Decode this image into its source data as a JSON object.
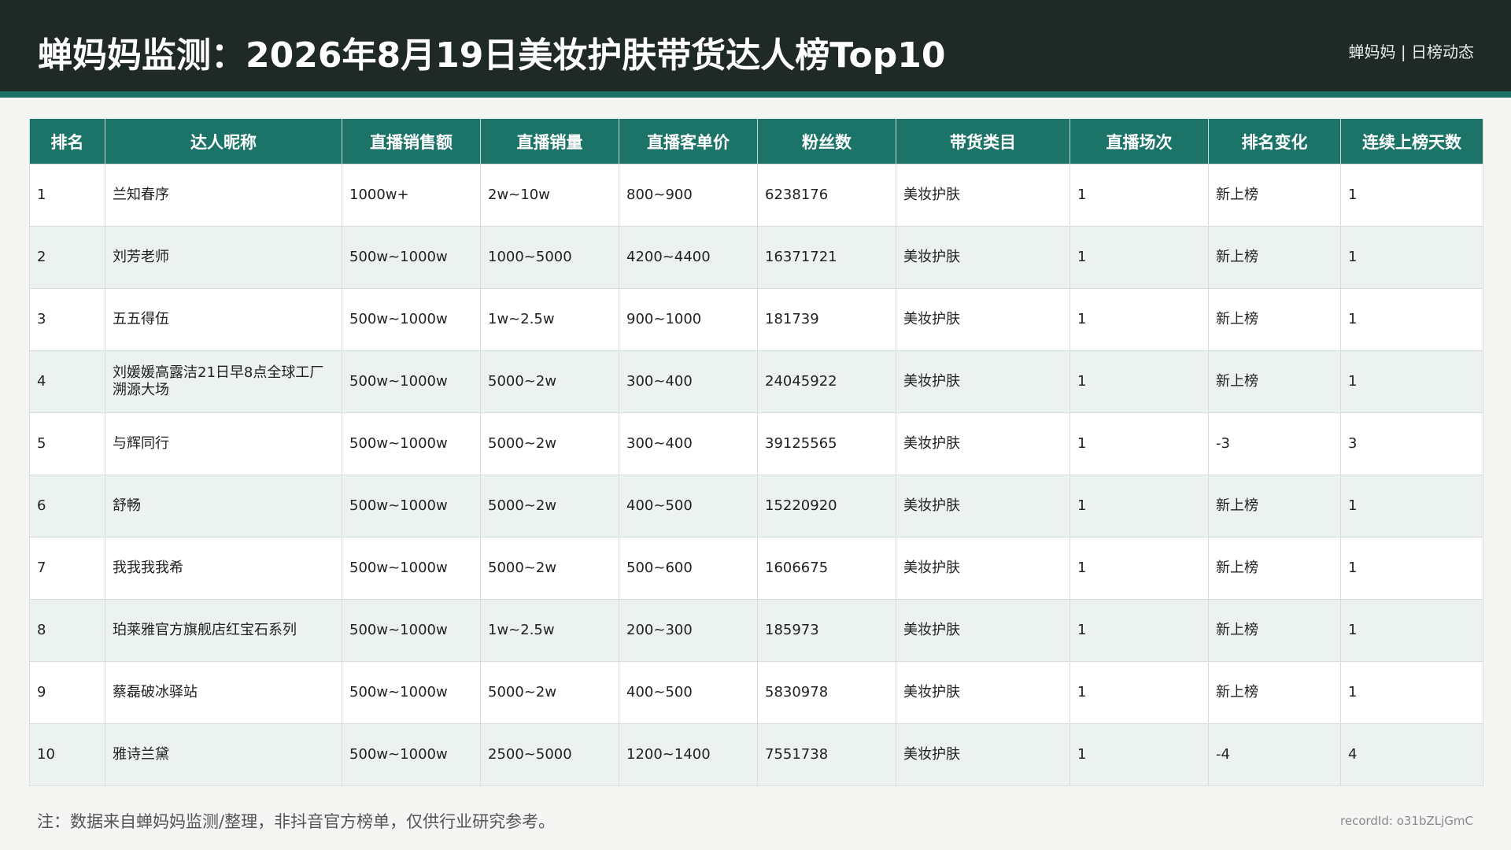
{
  "header": {
    "title": "蝉妈妈监测：2026年8月19日美妆护肤带货达人榜Top10",
    "brand": "蝉妈妈 | 日榜动态"
  },
  "colors": {
    "header_bg": "#1f2926",
    "accent": "#1b7467",
    "row_alt": "#ebf2ef"
  },
  "table": {
    "columns": [
      "排名",
      "达人昵称",
      "直播销售额",
      "直播销量",
      "直播客单价",
      "粉丝数",
      "带货类目",
      "直播场次",
      "排名变化",
      "连续上榜天数"
    ],
    "rows": [
      [
        "1",
        "兰知春序",
        "1000w+",
        "2w~10w",
        "800~900",
        "6238176",
        "美妆护肤",
        "1",
        "新上榜",
        "1"
      ],
      [
        "2",
        "刘芳老师",
        "500w~1000w",
        "1000~5000",
        "4200~4400",
        "16371721",
        "美妆护肤",
        "1",
        "新上榜",
        "1"
      ],
      [
        "3",
        "五五得伍",
        "500w~1000w",
        "1w~2.5w",
        "900~1000",
        "181739",
        "美妆护肤",
        "1",
        "新上榜",
        "1"
      ],
      [
        "4",
        "刘媛媛高露洁21日早8点全球工厂溯源大场",
        "500w~1000w",
        "5000~2w",
        "300~400",
        "24045922",
        "美妆护肤",
        "1",
        "新上榜",
        "1"
      ],
      [
        "5",
        "与辉同行",
        "500w~1000w",
        "5000~2w",
        "300~400",
        "39125565",
        "美妆护肤",
        "1",
        "-3",
        "3"
      ],
      [
        "6",
        "舒畅",
        "500w~1000w",
        "5000~2w",
        "400~500",
        "15220920",
        "美妆护肤",
        "1",
        "新上榜",
        "1"
      ],
      [
        "7",
        "我我我我希",
        "500w~1000w",
        "5000~2w",
        "500~600",
        "1606675",
        "美妆护肤",
        "1",
        "新上榜",
        "1"
      ],
      [
        "8",
        "珀莱雅官方旗舰店红宝石系列",
        "500w~1000w",
        "1w~2.5w",
        "200~300",
        "185973",
        "美妆护肤",
        "1",
        "新上榜",
        "1"
      ],
      [
        "9",
        "蔡磊破冰驿站",
        "500w~1000w",
        "5000~2w",
        "400~500",
        "5830978",
        "美妆护肤",
        "1",
        "新上榜",
        "1"
      ],
      [
        "10",
        "雅诗兰黛",
        "500w~1000w",
        "2500~5000",
        "1200~1400",
        "7551738",
        "美妆护肤",
        "1",
        "-4",
        "4"
      ]
    ]
  },
  "footer": {
    "note": "注：数据来自蝉妈妈监测/整理，非抖音官方榜单，仅供行业研究参考。",
    "record_id": "recordId: o31bZLjGmC"
  }
}
